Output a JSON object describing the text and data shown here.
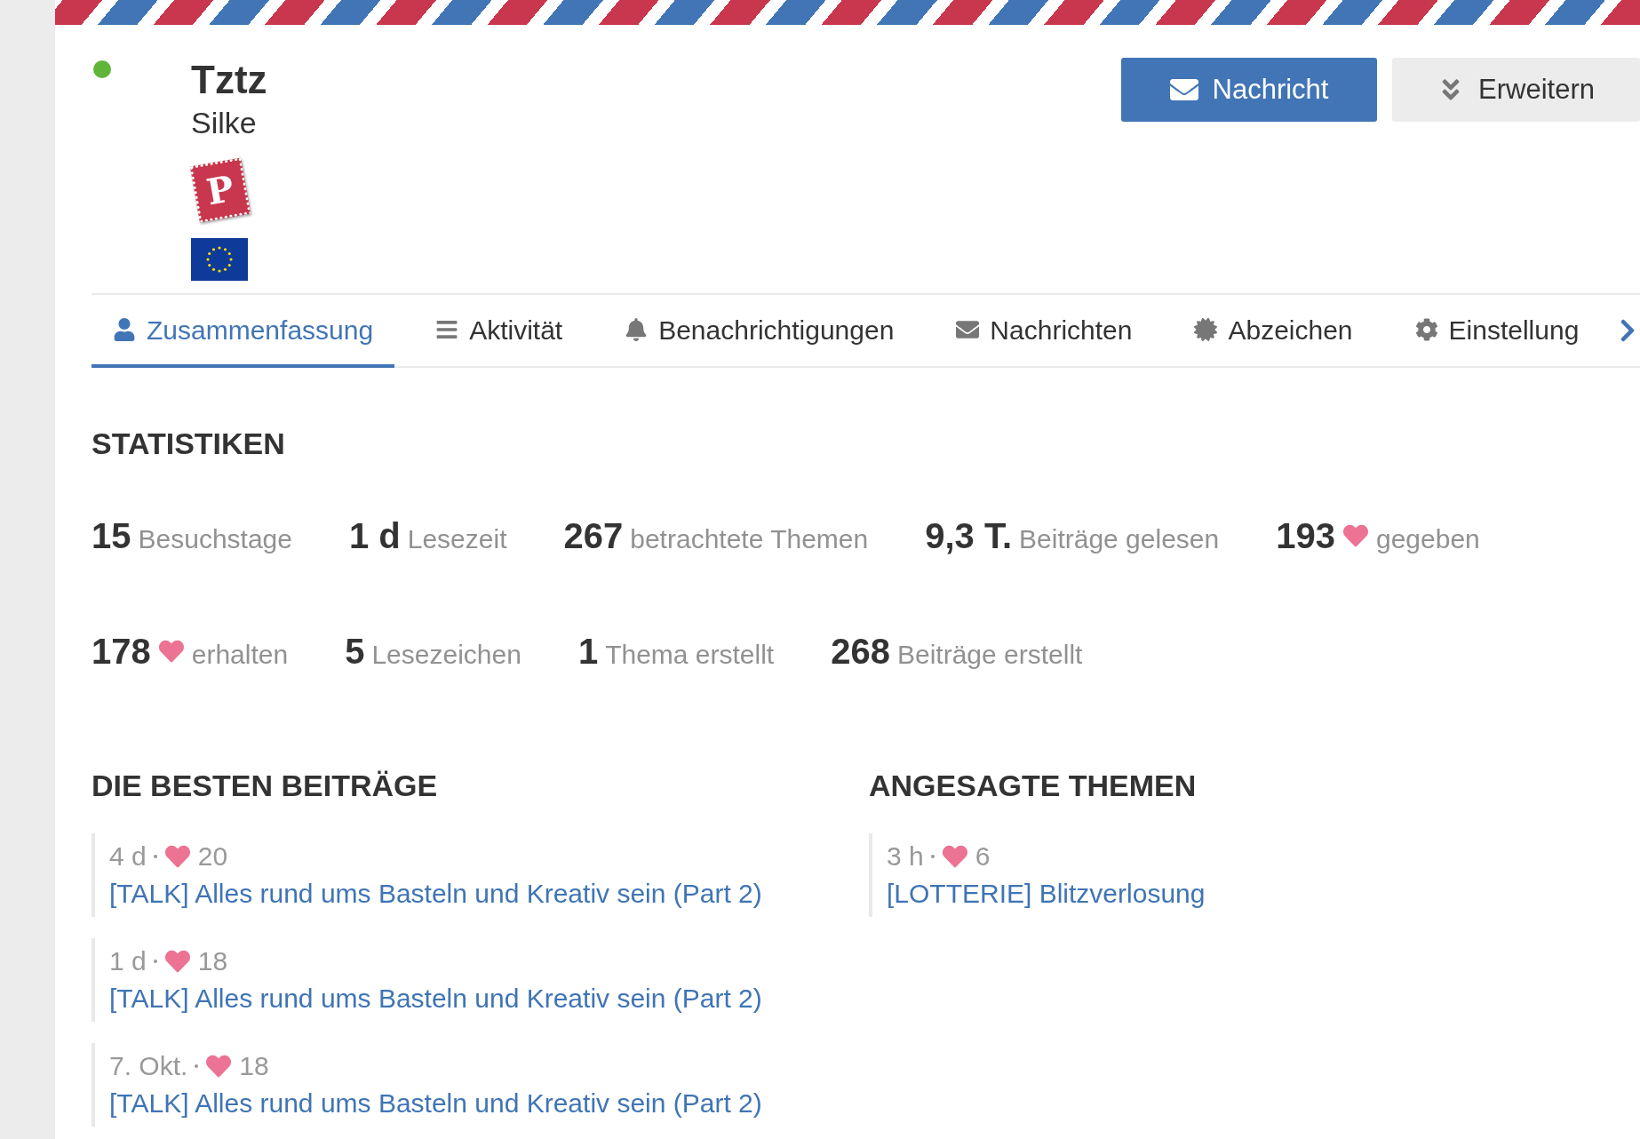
{
  "profile": {
    "online": true,
    "username": "Tztz",
    "name": "Silke",
    "stamp_letter": "P"
  },
  "actions": [
    {
      "kind": "primary",
      "label": "Nachricht"
    },
    {
      "kind": "secondary",
      "label": "Erweitern"
    }
  ],
  "tabs": [
    {
      "label": "Zusammenfassung",
      "selected": true
    },
    {
      "label": "Aktivität",
      "selected": false
    },
    {
      "label": "Benachrichtigungen",
      "selected": false
    },
    {
      "label": "Nachrichten",
      "selected": false
    },
    {
      "label": "Abzeichen",
      "selected": false
    },
    {
      "label": "Einstellung",
      "selected": false
    }
  ],
  "stats": {
    "title": "STATISTIKEN",
    "rows": [
      [
        {
          "value": "15",
          "heart": false,
          "label": "Besuchstage"
        },
        {
          "value": "1 d",
          "heart": false,
          "label": "Lesezeit"
        },
        {
          "value": "267",
          "heart": false,
          "label": "betrachtete Themen"
        },
        {
          "value": "9,3 T.",
          "heart": false,
          "label": "Beiträge gelesen"
        },
        {
          "value": "193",
          "heart": true,
          "label": "gegeben"
        }
      ],
      [
        {
          "value": "178",
          "heart": true,
          "label": "erhalten"
        },
        {
          "value": "5",
          "heart": false,
          "label": "Lesezeichen"
        },
        {
          "value": "1",
          "heart": false,
          "label": "Thema erstellt"
        },
        {
          "value": "268",
          "heart": false,
          "label": "Beiträge erstellt"
        }
      ]
    ]
  },
  "sections": [
    {
      "title": "DIE BESTEN BEITRÄGE",
      "items": [
        {
          "age": "4 d",
          "likes": "20",
          "title": "[TALK] Alles rund ums Basteln und Kreativ sein (Part 2)"
        },
        {
          "age": "1 d",
          "likes": "18",
          "title": "[TALK] Alles rund ums Basteln und Kreativ sein (Part 2)"
        },
        {
          "age": "7. Okt.",
          "likes": "18",
          "title": "[TALK] Alles rund ums Basteln und Kreativ sein (Part 2)"
        }
      ]
    },
    {
      "title": "ANGESAGTE THEMEN",
      "items": [
        {
          "age": "3 h",
          "likes": "6",
          "title": "[LOTTERIE] Blitzverlosung"
        }
      ]
    }
  ]
}
